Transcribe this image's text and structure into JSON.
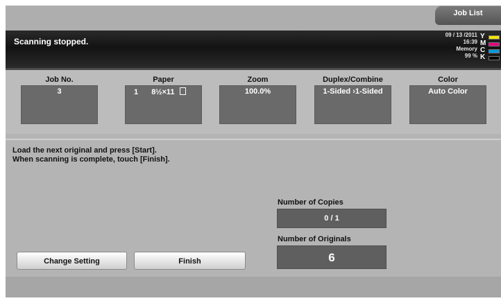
{
  "header": {
    "job_list_label": "Job List"
  },
  "status": {
    "message": "Scanning stopped.",
    "date": "09 / 13 /2011",
    "time": "16:39",
    "memory_label": "Memory",
    "memory_value": "99 %",
    "toner": [
      {
        "letter": "Y",
        "color": "#f2e600"
      },
      {
        "letter": "M",
        "color": "#e6007e"
      },
      {
        "letter": "C",
        "color": "#0099e0"
      },
      {
        "letter": "K",
        "color": "#000000"
      }
    ]
  },
  "job": {
    "job_no_label": "Job No.",
    "job_no_value": "3",
    "paper_label": "Paper",
    "paper_tray": "1",
    "paper_size": "8½×11",
    "zoom_label": "Zoom",
    "zoom_value": "100.0%",
    "duplex_label": "Duplex/Combine",
    "duplex_value": "1-Sided ›1-Sided",
    "color_label": "Color",
    "color_value": "Auto Color"
  },
  "main": {
    "instruction_line1": "Load the next original and press [Start].",
    "instruction_line2": "When scanning is complete, touch [Finish].",
    "copies_label": "Number of Copies",
    "copies_value": "0  /  1",
    "originals_label": "Number of Originals",
    "originals_value": "6",
    "change_setting_label": "Change Setting",
    "finish_label": "Finish"
  }
}
